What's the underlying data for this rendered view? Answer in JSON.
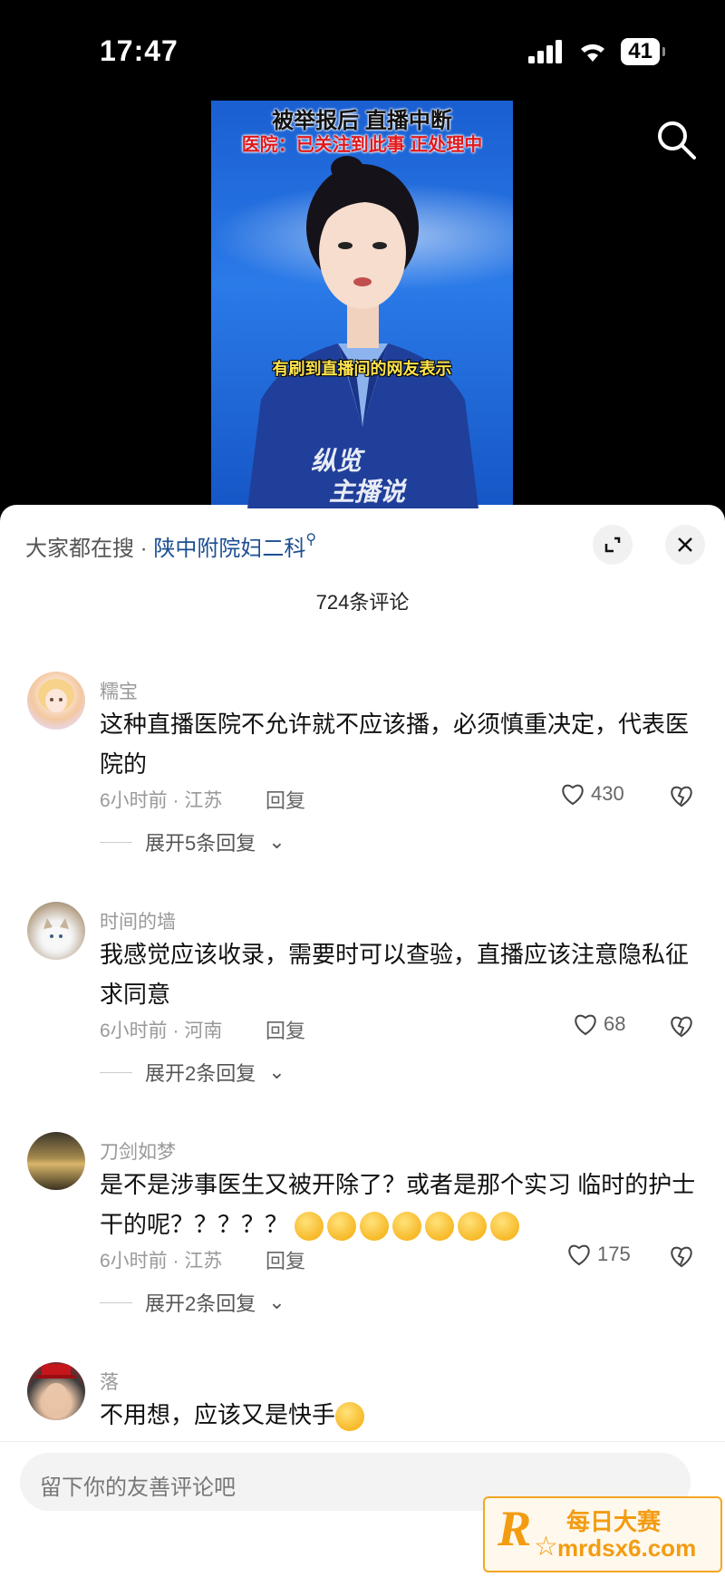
{
  "status_bar": {
    "time": "17:47",
    "battery": "41"
  },
  "video": {
    "headline": "被举报后 直播中断",
    "subheadline": "医院：已关注到此事 正处理中",
    "caption": "有刷到直播间的网友表示",
    "brand_line1": "纵览",
    "brand_line2": "主播说"
  },
  "sheet": {
    "hot_search_label": "大家都在搜 · ",
    "hot_search_term": "陕中附院妇二科",
    "comment_count": "724条评论"
  },
  "comments": [
    {
      "user": "糯宝",
      "text": "这种直播医院不允许就不应该播，必须慎重决定，代表医院的",
      "meta": "6小时前 · 江苏",
      "reply": "回复",
      "likes": "430",
      "expand": "展开5条回复"
    },
    {
      "user": "时间的墙",
      "text": "我感觉应该收录，需要时可以查验，直播应该注意隐私征求同意",
      "meta": "6小时前 · 河南",
      "reply": "回复",
      "likes": "68",
      "expand": "展开2条回复"
    },
    {
      "user": "刀剑如梦",
      "text": "是不是涉事医生又被开除了？或者是那个实习 临时的护士干的呢？？？？？",
      "meta": "6小时前 · 江苏",
      "reply": "回复",
      "likes": "175",
      "expand": "展开2条回复"
    },
    {
      "user": "落",
      "text": "不用想，应该又是快手"
    }
  ],
  "input": {
    "placeholder": "留下你的友善评论吧"
  },
  "watermark": {
    "line1": "每日大赛",
    "line2": "mrdsx6.com",
    "logo_letter": "R"
  },
  "colors": {
    "accent_link": "#1d4f91",
    "watermark": "#f39c12",
    "video_bg": "#1a5fd1"
  }
}
